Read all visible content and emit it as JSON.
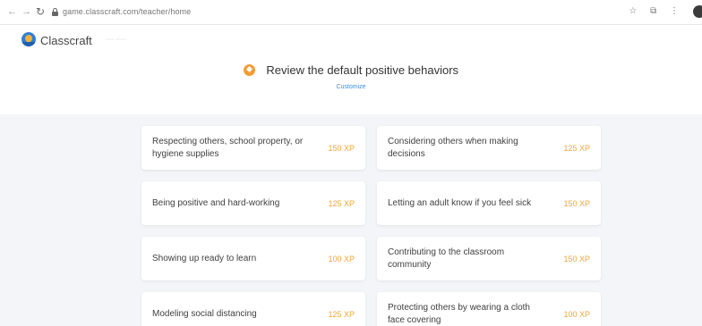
{
  "browser": {
    "url": "game.classcraft.com/teacher/home",
    "icons": [
      "star-icon",
      "extensions-icon",
      "menu-icon"
    ]
  },
  "header": {
    "brand": "Classcraft",
    "brand_sub": "···· ·····",
    "title": "Review the default positive behaviors",
    "subtitle": "Customize"
  },
  "behaviors": [
    {
      "label": "Respecting others, school property, or hygiene supplies",
      "xp": "150 XP"
    },
    {
      "label": "Considering others when making decisions",
      "xp": "125 XP"
    },
    {
      "label": "Being positive and hard-working",
      "xp": "125 XP"
    },
    {
      "label": "Letting an adult know if you feel sick",
      "xp": "150 XP"
    },
    {
      "label": "Showing up ready to learn",
      "xp": "100 XP"
    },
    {
      "label": "Contributing to the classroom community",
      "xp": "150 XP"
    },
    {
      "label": "Modeling social distancing",
      "xp": "125 XP"
    },
    {
      "label": "Protecting others by wearing a cloth face covering",
      "xp": "100 XP"
    }
  ],
  "colors": {
    "accent_orange": "#f39c34",
    "xp_orange": "#f0a63b",
    "link_blue": "#3a8ee6",
    "background": "#f3f5f8"
  }
}
